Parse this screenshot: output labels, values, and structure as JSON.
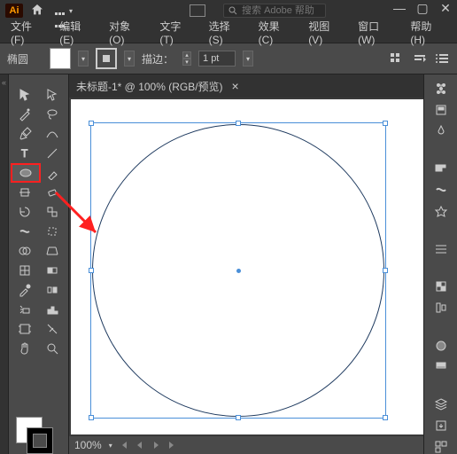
{
  "app": {
    "logo": "Ai"
  },
  "search": {
    "placeholder": "搜索 Adobe 帮助"
  },
  "menu": {
    "file": "文件(F)",
    "edit": "编辑(E)",
    "object": "对象(O)",
    "type": "文字(T)",
    "select": "选择(S)",
    "effect": "效果(C)",
    "view": "视图(V)",
    "window": "窗口(W)",
    "help": "帮助(H)"
  },
  "optbar": {
    "shape": "椭圆",
    "stroke_label": "描边：",
    "stroke_weight": "1 pt"
  },
  "tab": {
    "title": "未标题-1* @ 100% (RGB/预览)"
  },
  "status": {
    "zoom": "100%"
  },
  "chart_data": null
}
